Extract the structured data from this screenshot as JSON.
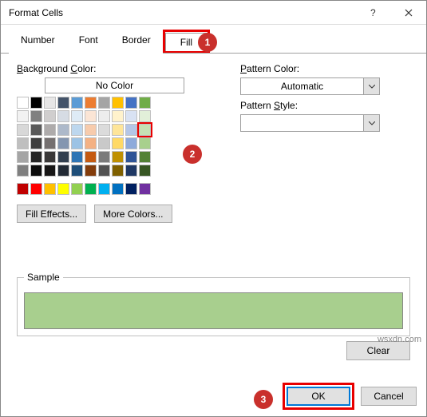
{
  "title": "Format Cells",
  "tabs": {
    "number": "Number",
    "font": "Font",
    "border": "Border",
    "fill": "Fill"
  },
  "labels": {
    "background_color": "Background Color:",
    "no_color": "No Color",
    "pattern_color": "Pattern Color:",
    "pattern_style": "Pattern Style:",
    "sample": "Sample"
  },
  "pattern_color_value": "Automatic",
  "pattern_style_value": "",
  "buttons": {
    "fill_effects": "Fill Effects...",
    "more_colors": "More Colors...",
    "clear": "Clear",
    "ok": "OK",
    "cancel": "Cancel"
  },
  "markers": {
    "m1": "1",
    "m2": "2",
    "m3": "3"
  },
  "watermark": "wsxdn.com",
  "selected_color": "#c5e0b3",
  "sample_color": "#a8cf8e",
  "palette_rows_a": [
    [
      "#ffffff",
      "#000000",
      "#e7e6e6",
      "#44546a",
      "#5b9bd5",
      "#ed7d31",
      "#a5a5a5",
      "#ffc000",
      "#4472c4",
      "#70ad47"
    ],
    [
      "#f2f2f2",
      "#808080",
      "#d0cece",
      "#d6dce4",
      "#deebf6",
      "#fbe5d5",
      "#ededed",
      "#fff2cc",
      "#d9e2f3",
      "#e2efd9"
    ],
    [
      "#d8d8d8",
      "#595959",
      "#aeabab",
      "#adb9ca",
      "#bdd7ee",
      "#f7cbac",
      "#dbdbdb",
      "#fee599",
      "#b4c6e7",
      "#c5e0b3"
    ],
    [
      "#bfbfbf",
      "#3f3f3f",
      "#757070",
      "#8496b0",
      "#9cc3e5",
      "#f4b183",
      "#c9c9c9",
      "#ffd965",
      "#8eaadb",
      "#a8d08d"
    ],
    [
      "#a5a5a5",
      "#262626",
      "#3a3838",
      "#323f4f",
      "#2e75b5",
      "#c55a11",
      "#7b7b7b",
      "#bf9000",
      "#2f5496",
      "#538135"
    ],
    [
      "#7f7f7f",
      "#0c0c0c",
      "#171616",
      "#222a35",
      "#1e4e79",
      "#833c0b",
      "#525252",
      "#7f6000",
      "#1f3864",
      "#375623"
    ]
  ],
  "palette_row_b": [
    "#c00000",
    "#ff0000",
    "#ffc000",
    "#ffff00",
    "#92d050",
    "#00b050",
    "#00b0f0",
    "#0070c0",
    "#002060",
    "#7030a0"
  ]
}
